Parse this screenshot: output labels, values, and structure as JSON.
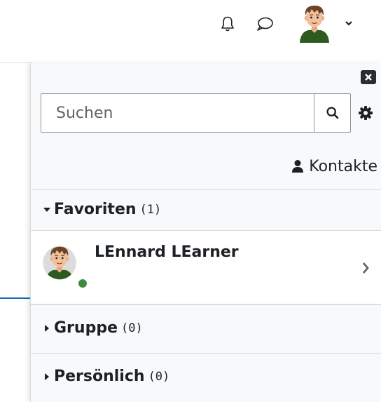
{
  "navbar": {
    "icons": {
      "notifications": "bell-icon",
      "messages": "chat-bubble-icon",
      "user_menu": "chevron-down-icon"
    }
  },
  "drawer": {
    "close_icon": "close-icon",
    "search": {
      "placeholder": "Suchen",
      "value": "",
      "button_icon": "search-icon"
    },
    "settings_icon": "gear-icon",
    "contacts_link": {
      "label": "Kontakte",
      "icon": "user-icon"
    },
    "sections": {
      "favorites": {
        "label": "Favoriten",
        "count": "(1)",
        "expanded": true,
        "contacts": [
          {
            "name": "LEnnard LEarner",
            "online": true
          }
        ]
      },
      "group": {
        "label": "Gruppe",
        "count": "(0)",
        "expanded": false
      },
      "private": {
        "label": "Persönlich",
        "count": "(0)",
        "expanded": false
      }
    }
  },
  "colors": {
    "drawer_background": "#f8f9fa",
    "online_status": "#3a8d3a",
    "link_accent": "#0f6cbf",
    "text": "#1d2125"
  }
}
